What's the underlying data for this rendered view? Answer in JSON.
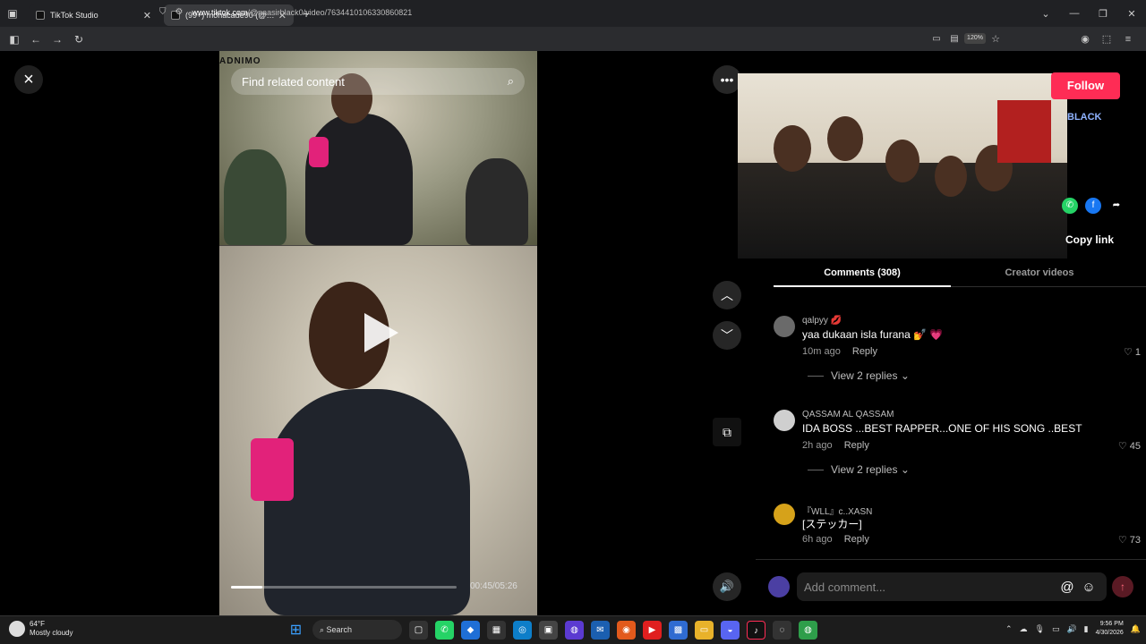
{
  "browser": {
    "tabs": [
      {
        "title": "TikTok Studio",
        "active": false
      },
      {
        "title": "(99+) mohacade90 (@mohaclip",
        "active": true
      }
    ],
    "url_host": "www.tiktok.com",
    "url_path": "/@naasirblack0/video/7634410106330860821",
    "zoom": "120%"
  },
  "video": {
    "search_placeholder": "Find related content",
    "logo_text": "ADNIMO",
    "timecode": "00:45/05:26",
    "progress": 0.14
  },
  "panel": {
    "follow_label": "Follow",
    "author_fragment": "BLACK",
    "copy_link_label": "Copy link",
    "tab_comments": "Comments (308)",
    "tab_creator": "Creator videos"
  },
  "comments": [
    {
      "user": "qalpyy 💋",
      "text": "yaa dukaan isla furana 💅 💗",
      "time": "10m ago",
      "reply": "Reply",
      "likes": "1",
      "replies": "View 2 replies",
      "avatar_color": "#6a6a6a"
    },
    {
      "user": "QASSAM AL QASSAM",
      "text": "IDA BOSS ...BEST RAPPER...ONE OF HIS SONG ..BEST",
      "time": "2h ago",
      "reply": "Reply",
      "likes": "45",
      "replies": "View 2 replies",
      "avatar_color": "#cfcfcf"
    },
    {
      "user": "『WLL』c..XASN",
      "text": "[ステッカー]",
      "time": "6h ago",
      "reply": "Reply",
      "likes": "73",
      "replies": "",
      "avatar_color": "#d6a21a"
    }
  ],
  "input": {
    "placeholder": "Add comment..."
  },
  "taskbar": {
    "temp": "64°F",
    "weather": "Mostly cloudy",
    "search": "Search",
    "time": "9:56 PM",
    "date": "4/30/2026"
  },
  "colors": {
    "accent": "#fe2c55",
    "background": "#000000"
  }
}
